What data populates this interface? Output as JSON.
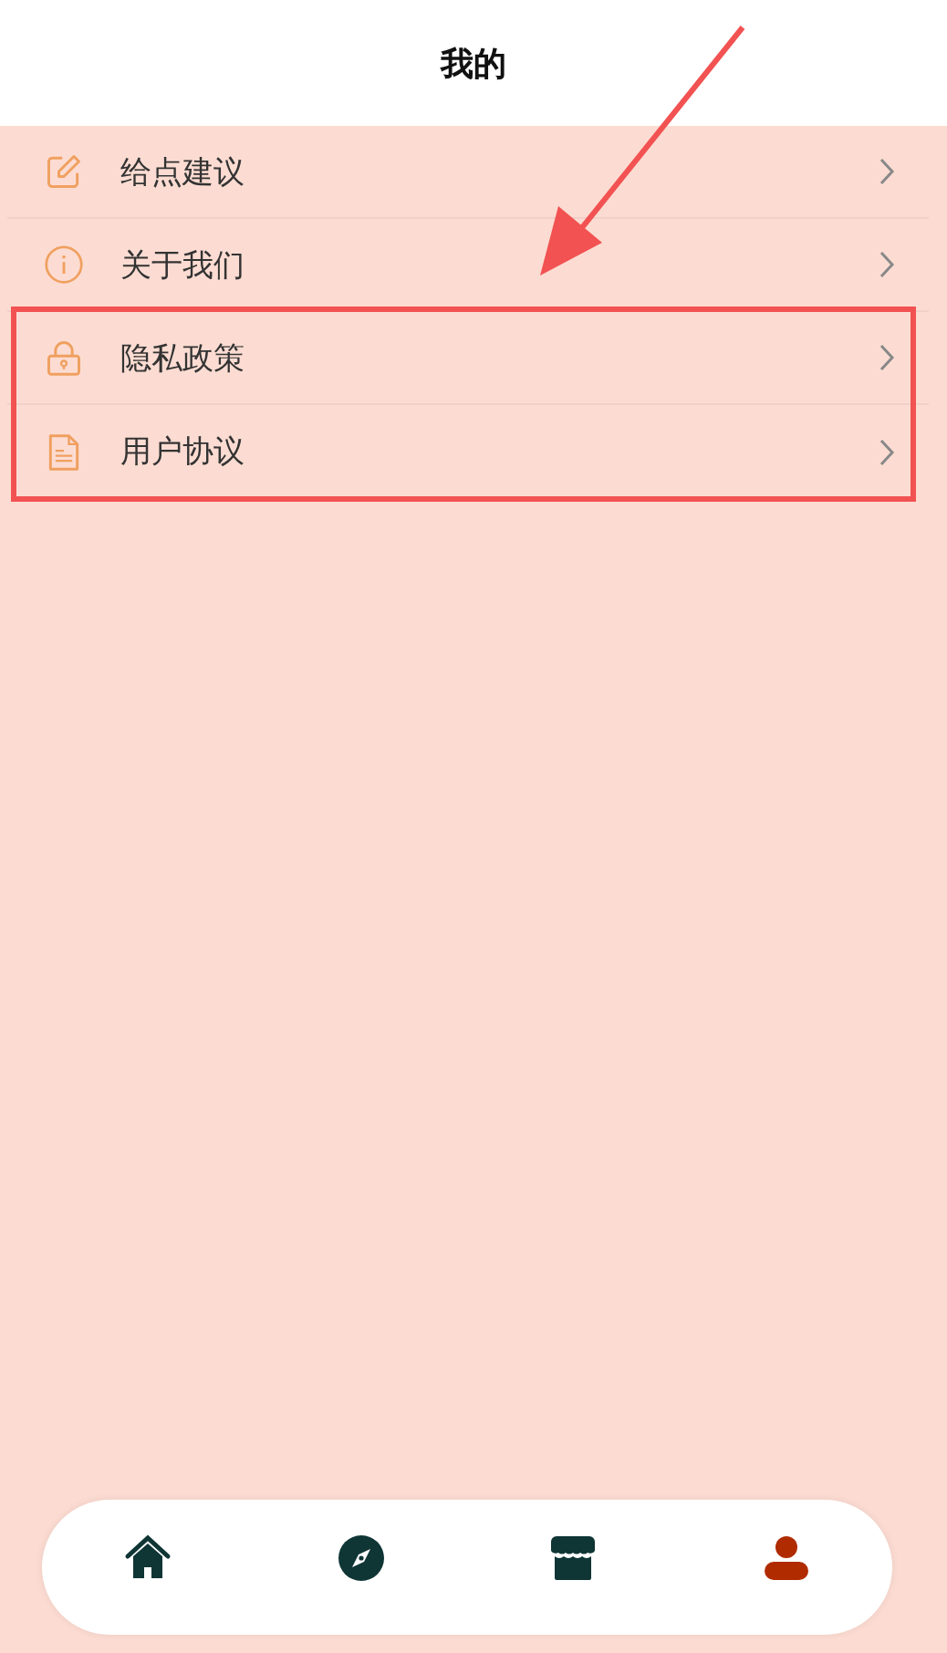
{
  "header": {
    "title": "我的"
  },
  "menu_items": [
    {
      "label": "给点建议",
      "kind": "edit"
    },
    {
      "label": "关于我们",
      "kind": "info"
    },
    {
      "label": "隐私政策",
      "kind": "lock"
    },
    {
      "label": "用户协议",
      "kind": "document"
    }
  ],
  "tab_bar": [
    {
      "kind": "home",
      "selected": false
    },
    {
      "kind": "compass",
      "selected": false
    },
    {
      "kind": "store",
      "selected": false
    },
    {
      "kind": "person",
      "selected": true
    }
  ],
  "annotations": [
    {
      "kind": "arrow"
    },
    {
      "kind": "box"
    }
  ]
}
